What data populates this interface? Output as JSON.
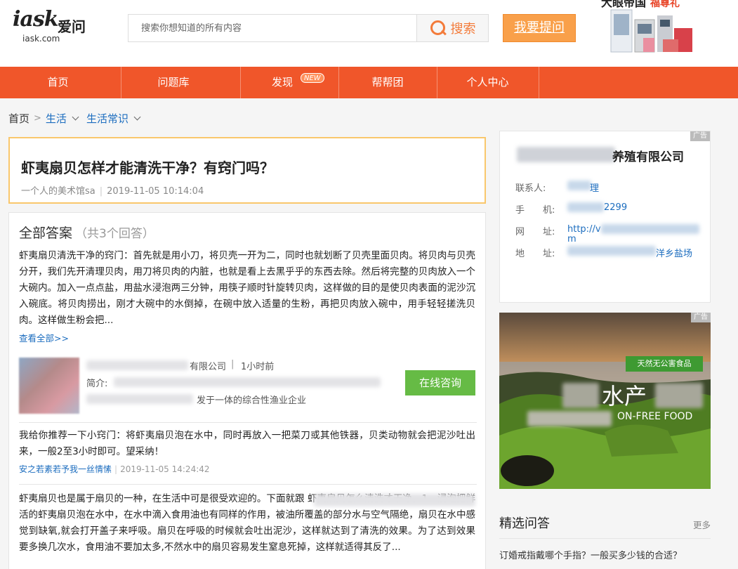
{
  "brand": {
    "logo_text": "iask",
    "logo_cn": "爱问",
    "logo_sub": "iask.com"
  },
  "search": {
    "placeholder": "搜索你想知道的所有内容",
    "button_label": "搜索"
  },
  "header": {
    "ask_button": "我要提问",
    "ad_title": "大眼帝国",
    "ad_subtitle": "福尊礼"
  },
  "nav": {
    "items": [
      {
        "label": "首页"
      },
      {
        "label": "问题库"
      },
      {
        "label": "发现",
        "badge": "NEW"
      },
      {
        "label": "帮帮团"
      },
      {
        "label": "个人中心"
      }
    ]
  },
  "breadcrumb": {
    "home": "首页",
    "sep": ">",
    "level1": "生活",
    "level2": "生活常识"
  },
  "question": {
    "title": "虾夷扇贝怎样才能清洗干净？有窍门吗？",
    "author": "一个人的美术馆sa",
    "time": "2019-11-05 10:14:04"
  },
  "answers": {
    "heading": "全部答案",
    "count": "（共3个回答）",
    "first_text": "虾夷扇贝清洗干净的窍门：首先就是用小刀，将贝壳一开为二，同时也就划断了贝壳里面贝肉。将贝肉与贝壳分开，我们先开清理贝肉，用刀将贝肉的内脏，也就是看上去黑乎乎的东西去除。然后将完整的贝肉放入一个大碗内。加入一点点盐，用盐水浸泡两三分钟，用筷子顺时针旋转贝肉，这样做的目的是使贝肉表面的泥沙沉入碗底。将贝肉捞出，刚才大碗中的水倒掉，在碗中放入适量的生粉，再把贝肉放入碗中，用手轻轻搓洗贝肉。这样做生粉会把...",
    "view_all": "查看全部>>",
    "company": {
      "name_suffix": "有限公司",
      "time": "1小时前",
      "intro_label": "简介:",
      "intro_end": "发于一体的综合性渔业企业",
      "consult_button": "在线咨询"
    },
    "second_text": "我给你推荐一下小窍门：将虾夷扇贝泡在水中，同时再放入一把菜刀或其他铁器，贝类动物就会把泥沙吐出来，一般2至3小时即可。望采纳！",
    "second_user": "安之若素若予我一丝情愫",
    "second_time": "2019-11-05 14:24:42",
    "third_text": "虾夷扇贝也是属于扇贝的一种，在生活中可是很受欢迎的。下面就跟                        虾夷扇贝怎么清洗才干净。1、浸泡把鲜活的虾夷扇贝泡在水中，在水中滴入食用油也有同样的作用，被油所覆盖的部分水与空气隔绝，扇贝在水中感觉到缺氧,就会打开盖子来呼吸。扇贝在呼吸的时候就会吐出泥沙，这样就达到了清洗的效果。为了达到效果要多换几次水，食用油不要加太多,不然水中的扇贝容易发生窒息死掉，这样就适得其反了..."
  },
  "company_card": {
    "ad": "广告",
    "title_suffix": "养殖有限公司",
    "contact_label": "联系人:",
    "contact_value": "理",
    "phone_label": "手　　机:",
    "phone_value": "2299",
    "website_label": "网　　址:",
    "website_value": "http://v",
    "website_value2": "m",
    "address_label": "地　　址:",
    "address_value": "洋乡盐场"
  },
  "banner": {
    "ad": "广告",
    "tag": "天然无公害食品",
    "big_text": "水产",
    "eng_text": "ON-FREE FOOD"
  },
  "featured": {
    "title": "精选问答",
    "more": "更多",
    "item": "订婚戒指戴哪个手指？一般买多少钱的合适？"
  },
  "colors": {
    "accent": "#f0562a",
    "link": "#1c6dbf",
    "consult": "#66bb45",
    "ask": "#f9a04a"
  }
}
